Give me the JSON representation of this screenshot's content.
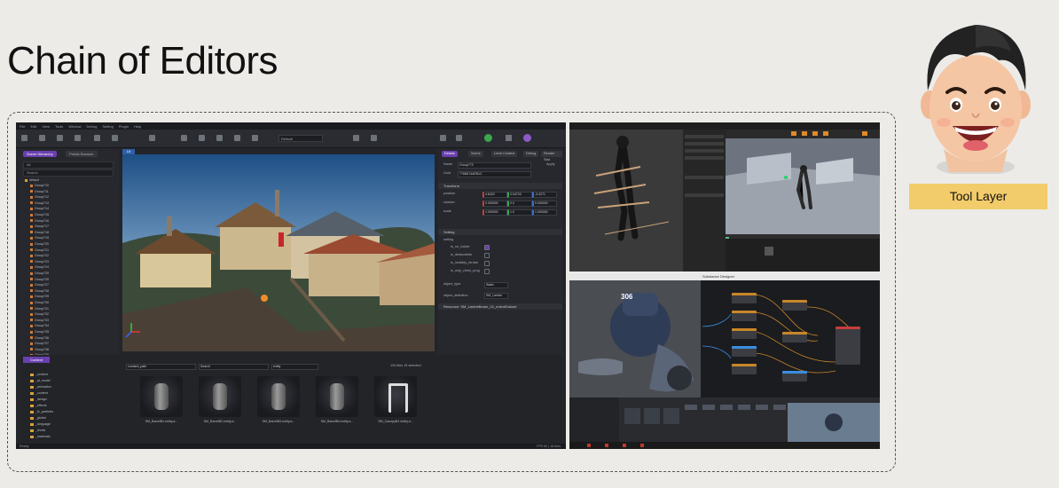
{
  "slide": {
    "title": "Chain of Editors",
    "badge": "Tool Layer"
  },
  "main_editor": {
    "menu": [
      "File",
      "Edit",
      "View",
      "Tools",
      "Window",
      "Debug",
      "Setting",
      "Plugin",
      "Help"
    ],
    "toolbar_dropdown": "Default",
    "left_tabs": [
      "Scene Hierarchy",
      "Prefab Browser"
    ],
    "filter_value": "All",
    "search_placeholder": "Search",
    "tree_root": "default",
    "tree_items": [
      "Group710",
      "Group711",
      "Group712",
      "Group713",
      "Group714",
      "Group715",
      "Group716",
      "Group717",
      "Group718",
      "Group719",
      "Group720",
      "Group721",
      "Group722",
      "Group723",
      "Group724",
      "Group725",
      "Group726",
      "Group727",
      "Group728",
      "Group729",
      "Group730",
      "Group731",
      "Group732",
      "Group733",
      "Group734",
      "Group735",
      "Group736",
      "Group737",
      "Group738",
      "Group739"
    ],
    "viewport_tab": "Lit",
    "right_tabs": [
      "Details",
      "Scene",
      "Level Context",
      "Debug",
      "Render Stat"
    ],
    "details": {
      "name_label": "Name",
      "name_value": "Group773",
      "apply_label": "Apply",
      "guid_label": "Guid",
      "guid_value": "7768D74AFB1C",
      "transform_section": "Transform",
      "rows": [
        {
          "label": "position",
          "x": "4.8420",
          "y": "0.04703",
          "z": "-3.4271"
        },
        {
          "label": "rotation",
          "x": "0.000000",
          "y": "0.0",
          "z": "0.000000"
        },
        {
          "label": "scale",
          "x": "1.000000",
          "y": "1.0",
          "z": "1.000000"
        }
      ],
      "setting_section": "Setting",
      "setting_label": "setting",
      "flags": [
        "is_no_holder",
        "is_destructible",
        "is_invisibly_terrain",
        "is_only_chest_prog"
      ],
      "object_type_label": "object_type",
      "object_type_value": "Static",
      "object_definition_label": "object_definition",
      "object_definition_value": "SM_Lambe",
      "footer_section": "Resource: SM_LambeBeam_01_nolentSubset"
    },
    "content_tab": "Content",
    "folders": [
      "_content",
      "_ai_model",
      "_animation",
      "_content",
      "_design",
      "_effects",
      "_fx_particles",
      "_global",
      "_language",
      "_levels",
      "_materials"
    ],
    "search_path": "/content_path",
    "search_box": "Search",
    "filter_box": "entity",
    "item_count": "134 files 15 selected",
    "assets": [
      "SM_BarrelB1.entity.a...",
      "SM_BarrelB2.entity.a...",
      "SM_BarrelB3.entity.a...",
      "SM_BarrelB4.entity.a...",
      "SM_CanopyB1.entity.a..."
    ],
    "status_left": "Ready",
    "status_right": "FPS 60 | 16.6ms"
  },
  "node_editor": {
    "title": "Substance Designer",
    "helmet_number": "306"
  },
  "colors": {
    "accent_purple": "#6a3fb0",
    "play_green": "#3aa74f",
    "badge_yellow": "#f2cc6a"
  }
}
